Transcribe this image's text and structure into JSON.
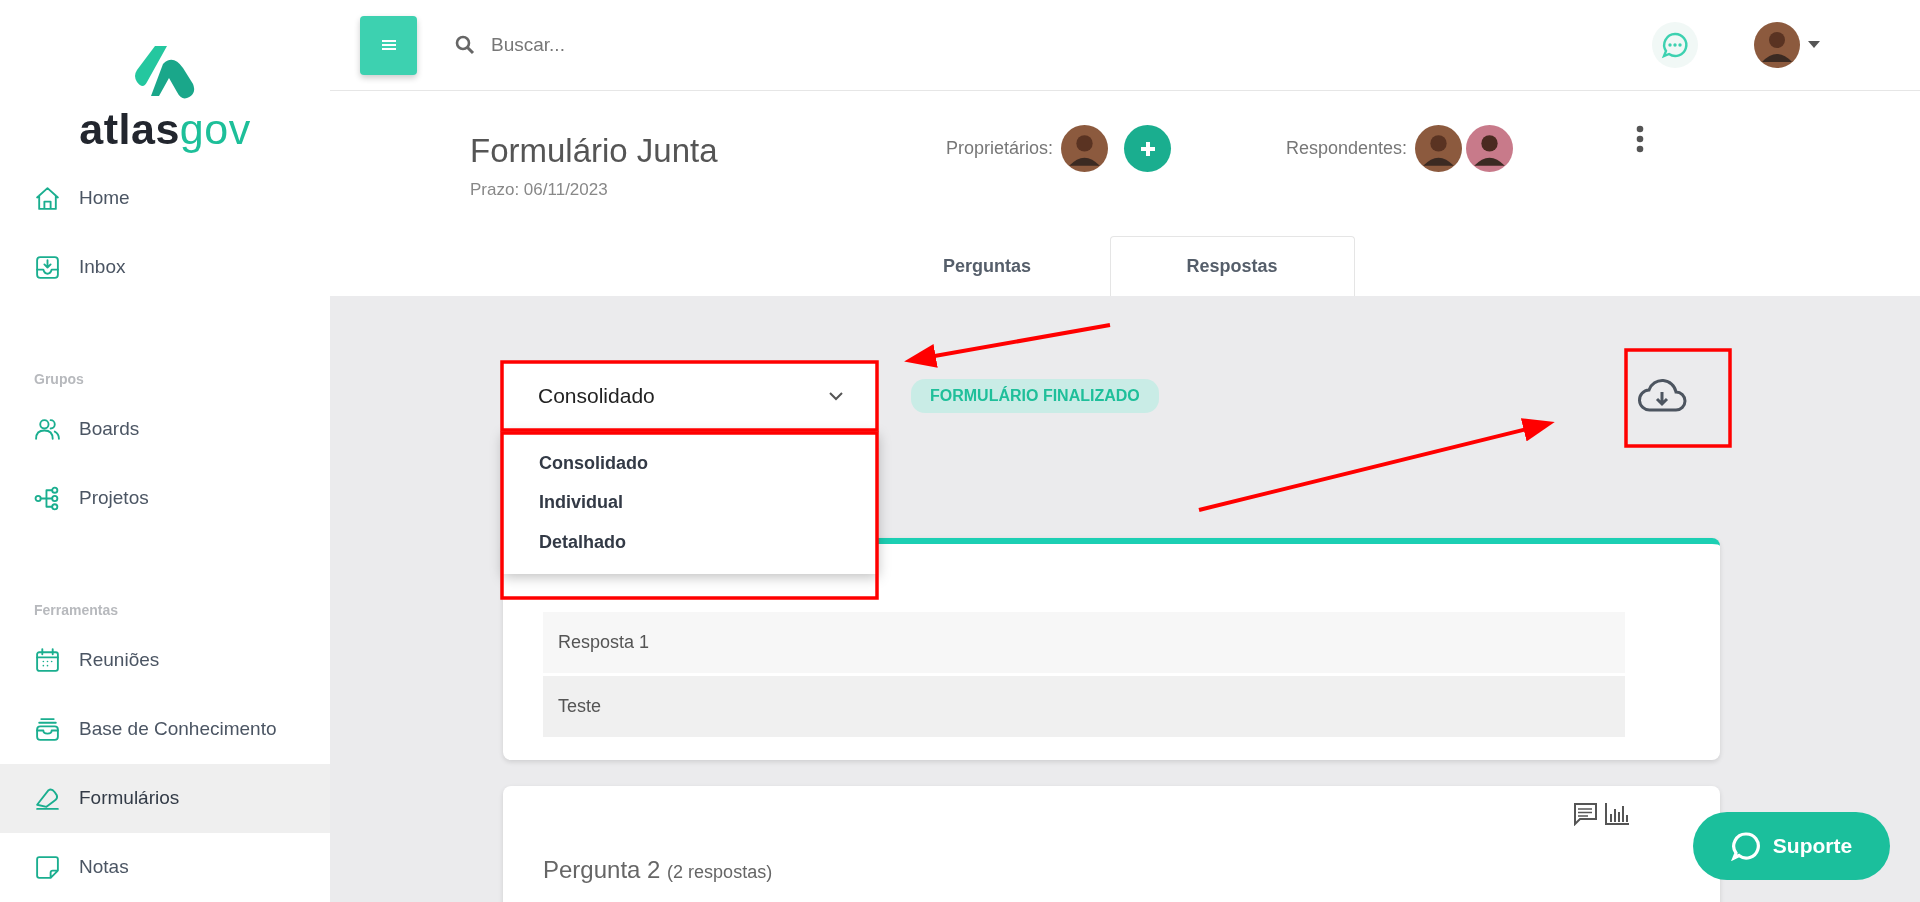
{
  "brand": {
    "text_dark": "atlas",
    "text_accent": "gov"
  },
  "sidebar": {
    "sections": [
      {
        "items": [
          {
            "label": "Home",
            "selected": false
          },
          {
            "label": "Inbox",
            "selected": false
          }
        ]
      },
      {
        "heading": "Grupos",
        "items": [
          {
            "label": "Boards",
            "selected": false
          },
          {
            "label": "Projetos",
            "selected": false
          }
        ]
      },
      {
        "heading": "Ferramentas",
        "items": [
          {
            "label": "Reuniões",
            "selected": false
          },
          {
            "label": "Base de Conhecimento",
            "selected": false
          },
          {
            "label": "Formulários",
            "selected": true
          },
          {
            "label": "Notas",
            "selected": false
          }
        ]
      }
    ]
  },
  "search": {
    "placeholder": "Buscar..."
  },
  "form": {
    "title": "Formulário Junta",
    "deadline": "Prazo: 06/11/2023",
    "owners_label": "Proprietários:",
    "respondents_label": "Respondentes:"
  },
  "tabs": [
    {
      "label": "Perguntas",
      "selected": false
    },
    {
      "label": "Respostas",
      "selected": true
    }
  ],
  "view_select": {
    "value": "Consolidado",
    "expanded": true,
    "options": [
      {
        "label": "Consolidado"
      },
      {
        "label": "Individual"
      },
      {
        "label": "Detalhado"
      }
    ]
  },
  "status_badge": "FORMULÁRIO FINALIZADO",
  "answers": [
    "Resposta 1",
    "Teste"
  ],
  "next_question": {
    "title": "Pergunta 2",
    "count": "(2 respostas)"
  },
  "support_button": "Suporte"
}
